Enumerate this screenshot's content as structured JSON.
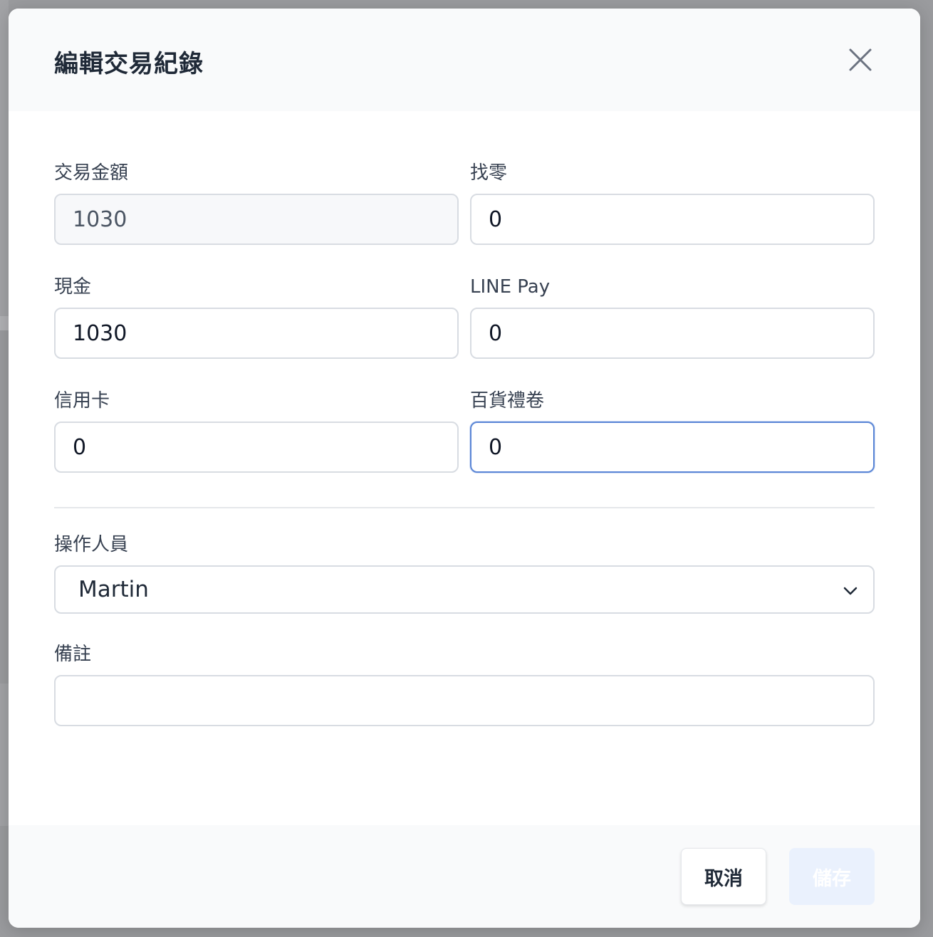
{
  "dialog": {
    "title": "編輯交易紀錄",
    "close_icon": "close-icon"
  },
  "fields": {
    "amount": {
      "label": "交易金額",
      "value": "1030",
      "readonly": true
    },
    "change": {
      "label": "找零",
      "value": "0"
    },
    "cash": {
      "label": "現金",
      "value": "1030"
    },
    "line_pay": {
      "label": "LINE Pay",
      "value": "0"
    },
    "credit_card": {
      "label": "信用卡",
      "value": "0"
    },
    "gift_voucher": {
      "label": "百貨禮卷",
      "value": "0",
      "focused": true
    }
  },
  "operator": {
    "label": "操作人員",
    "selected": "Martin",
    "icon": "chevron-down-icon"
  },
  "notes": {
    "label": "備註",
    "value": ""
  },
  "footer": {
    "cancel_label": "取消",
    "save_label": "儲存"
  },
  "colors": {
    "focus_border": "#5b86d6",
    "save_button_bg": "#eaf1fd",
    "header_bg": "#f9fafb"
  }
}
